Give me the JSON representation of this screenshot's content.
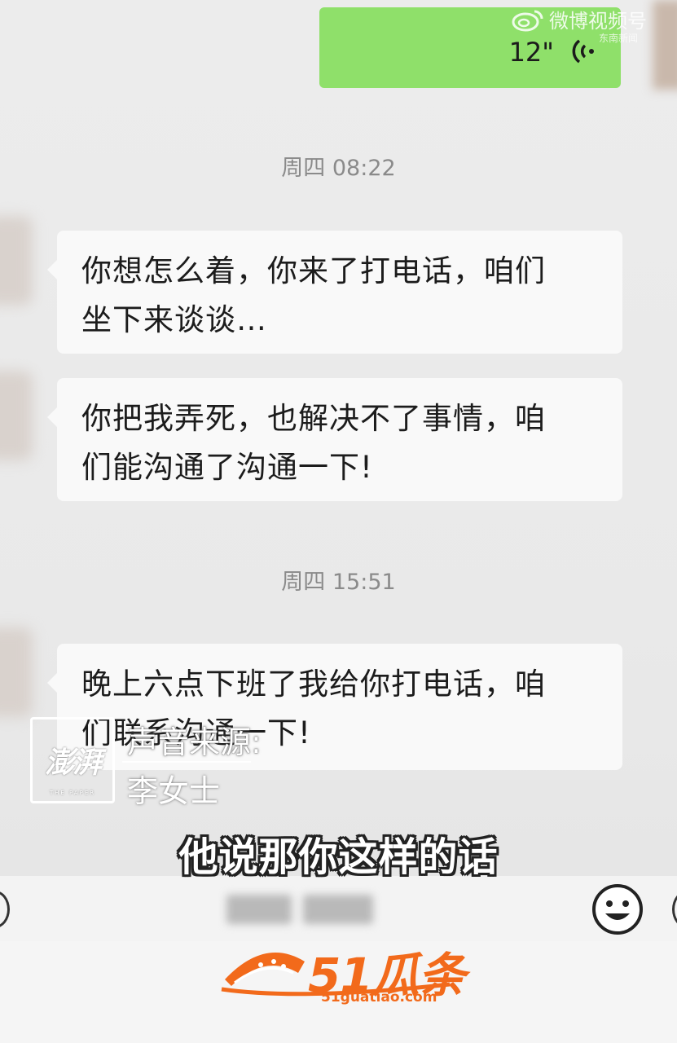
{
  "voice_message": {
    "duration": "12\""
  },
  "watermark": {
    "weibo": "微博视频号",
    "source": "东南新闻"
  },
  "messages": [
    {
      "time": "周四 08:22"
    },
    {
      "text_line1": "你想怎么着，你来了打电话，咱们",
      "text_line2": "坐下来谈谈…"
    },
    {
      "text_line1": "你把我弄死，也解决不了事情，咱",
      "text_line2": "们能沟通了沟通一下!"
    },
    {
      "time": "周四 15:51"
    },
    {
      "text_line1": "晚上六点下班了我给你打电话，咱",
      "text_line2": "们联系沟通一下!"
    }
  ],
  "overlay": {
    "logo": "澎湃",
    "logo_sub": "THE PAPER",
    "source_label": "声音来源:",
    "source_name": "李女士",
    "subtitle": "他说那你这样的话"
  },
  "site_logo": {
    "name": "51瓜条",
    "url": "51guatiao.com",
    "color": "#f26a1b"
  },
  "colors": {
    "voice_bubble": "#8fe06a",
    "incoming_bubble": "#f9f9f9",
    "background": "#ebebeb"
  }
}
